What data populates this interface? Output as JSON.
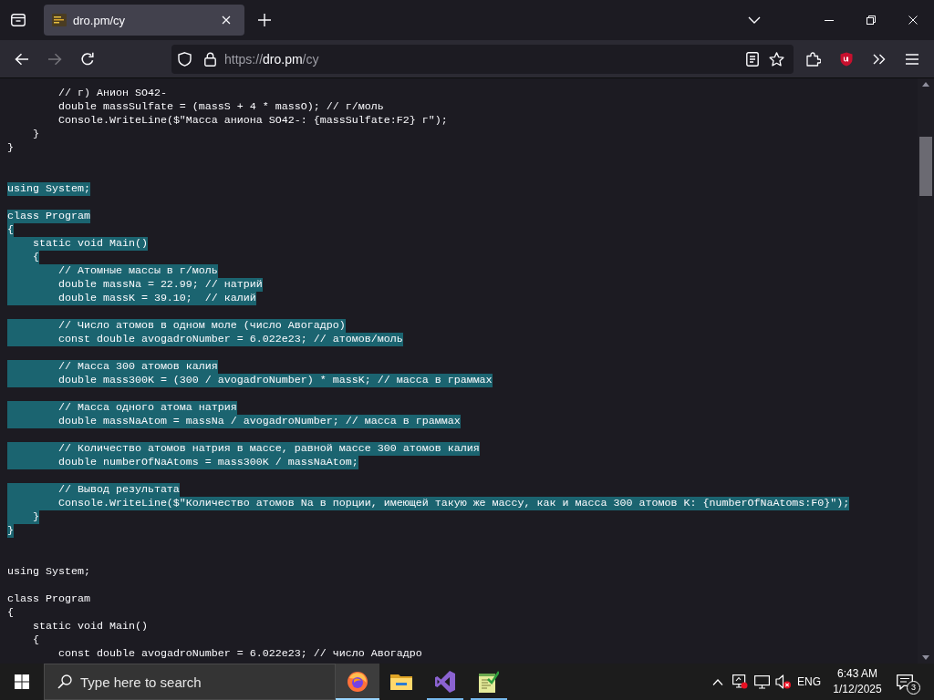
{
  "browser": {
    "tabs": [
      {
        "title": "dro.pm/cy",
        "selected": true
      }
    ],
    "nav_buttons": [
      {
        "kind": "back",
        "disabled": false
      },
      {
        "kind": "forward",
        "disabled": true
      },
      {
        "kind": "reload",
        "disabled": false
      }
    ],
    "address": {
      "scheme": "https://",
      "host": "dro.pm",
      "path": "/cy"
    }
  },
  "code_sections": [
    {
      "selected": false,
      "text": "        // г) Анион SO42-\n        double massSulfate = (massS + 4 * massO); // г/моль\n        Console.WriteLine($\"Масса аниона SO42-: {massSulfate:F2} г\");\n    }\n}\n\n"
    },
    {
      "selected": true,
      "text": "using System;\n\nclass Program\n{\n    static void Main()\n    {\n        // Атомные массы в г/моль\n        double massNa = 22.99; // натрий\n        double massK = 39.10;  // калий\n\n        // Число атомов в одном моле (число Авогадро)\n        const double avogadroNumber = 6.022e23; // атомов/моль\n\n        // Масса 300 атомов калия\n        double mass300K = (300 / avogadroNumber) * massK; // масса в граммах\n\n        // Масса одного атома натрия\n        double massNaAtom = massNa / avogadroNumber; // масса в граммах\n\n        // Количество атомов натрия в массе, равной массе 300 атомов калия\n        double numberOfNaAtoms = mass300K / massNaAtom;\n\n        // Вывод результата\n        Console.WriteLine($\"Количество атомов Na в порции, имеющей такую же массу, как и масса 300 атомов K: {numberOfNaAtoms:F0}\");\n    }\n}\n\n"
    },
    {
      "selected": false,
      "text": "using System;\n\nclass Program\n{\n    static void Main()\n    {\n        const double avogadroNumber = 6.022e23; // число Авогадро"
    }
  ],
  "taskbar": {
    "search": {
      "placeholder": "Type here to search"
    },
    "apps": [
      {
        "kind": "browser",
        "selected": true,
        "running": true
      },
      {
        "kind": "folder",
        "selected": false,
        "running": false
      },
      {
        "kind": "ide",
        "selected": false,
        "running": true
      },
      {
        "kind": "notepad",
        "selected": false,
        "running": true
      }
    ],
    "tray": {
      "sound_muted": true,
      "language": "ENG",
      "time": "6:43 AM",
      "date": "1/12/2025",
      "notification_count": "3"
    }
  }
}
